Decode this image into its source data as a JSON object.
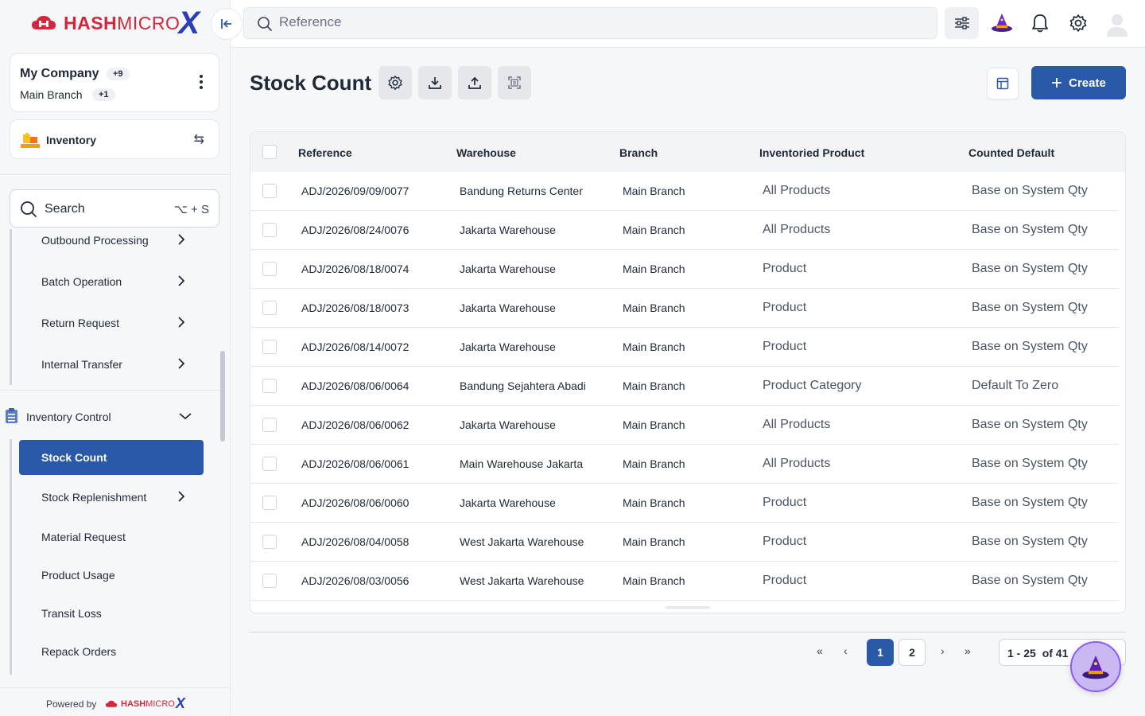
{
  "brand": {
    "name_bold": "HASH",
    "name_light": "MICRO",
    "x": "X",
    "color": "#d6263c",
    "x_color": "#2b3fb8"
  },
  "company": {
    "name": "My Company",
    "name_badge": "+9",
    "branch": "Main Branch",
    "branch_badge": "+1"
  },
  "module": {
    "label": "Inventory"
  },
  "sidebar_search": {
    "label": "Search",
    "shortcut": "⌥ + S"
  },
  "menu": {
    "items_top": [
      {
        "label": "Outbound Processing"
      },
      {
        "label": "Batch Operation"
      },
      {
        "label": "Return Request"
      },
      {
        "label": "Internal Transfer"
      }
    ],
    "section": {
      "label": "Inventory Control"
    },
    "items_section": [
      {
        "label": "Stock Count"
      },
      {
        "label": "Stock Replenishment"
      },
      {
        "label": "Material Request"
      },
      {
        "label": "Product Usage"
      },
      {
        "label": "Transit Loss"
      },
      {
        "label": "Repack Orders"
      }
    ]
  },
  "footer": {
    "powered_by": "Powered by",
    "brand_bold": "HASH",
    "brand_light": "MICRO",
    "brand_x": "X"
  },
  "topbar": {
    "search_placeholder": "Reference"
  },
  "page": {
    "title": "Stock Count",
    "create_label": "Create"
  },
  "table": {
    "columns": [
      "Reference",
      "Warehouse",
      "Branch",
      "Inventoried Product",
      "Counted Default"
    ],
    "rows": [
      [
        "ADJ/2026/09/09/0077",
        "Bandung Returns Center",
        "Main Branch",
        "All Products",
        "Base on System Qty"
      ],
      [
        "ADJ/2026/08/24/0076",
        "Jakarta Warehouse",
        "Main Branch",
        "All Products",
        "Base on System Qty"
      ],
      [
        "ADJ/2026/08/18/0074",
        "Jakarta Warehouse",
        "Main Branch",
        "Product",
        "Base on System Qty"
      ],
      [
        "ADJ/2026/08/18/0073",
        "Jakarta Warehouse",
        "Main Branch",
        "Product",
        "Base on System Qty"
      ],
      [
        "ADJ/2026/08/14/0072",
        "Jakarta Warehouse",
        "Main Branch",
        "Product",
        "Base on System Qty"
      ],
      [
        "ADJ/2026/08/06/0064",
        "Bandung Sejahtera Abadi",
        "Main Branch",
        "Product Category",
        "Default To Zero"
      ],
      [
        "ADJ/2026/08/06/0062",
        "Jakarta Warehouse",
        "Main Branch",
        "All Products",
        "Base on System Qty"
      ],
      [
        "ADJ/2026/08/06/0061",
        "Main Warehouse Jakarta",
        "Main Branch",
        "All Products",
        "Base on System Qty"
      ],
      [
        "ADJ/2026/08/06/0060",
        "Jakarta Warehouse",
        "Main Branch",
        "Product",
        "Base on System Qty"
      ],
      [
        "ADJ/2026/08/04/0058",
        "West Jakarta Warehouse",
        "Main Branch",
        "Product",
        "Base on System Qty"
      ],
      [
        "ADJ/2026/08/03/0056",
        "West Jakarta Warehouse",
        "Main Branch",
        "Product",
        "Base on System Qty"
      ]
    ]
  },
  "pagination": {
    "pages": [
      "1",
      "2"
    ],
    "current": "1",
    "range": "1 - 25",
    "of_text": "of 41"
  },
  "colors": {
    "primary": "#2a59a8",
    "accent_red": "#d6263c"
  }
}
